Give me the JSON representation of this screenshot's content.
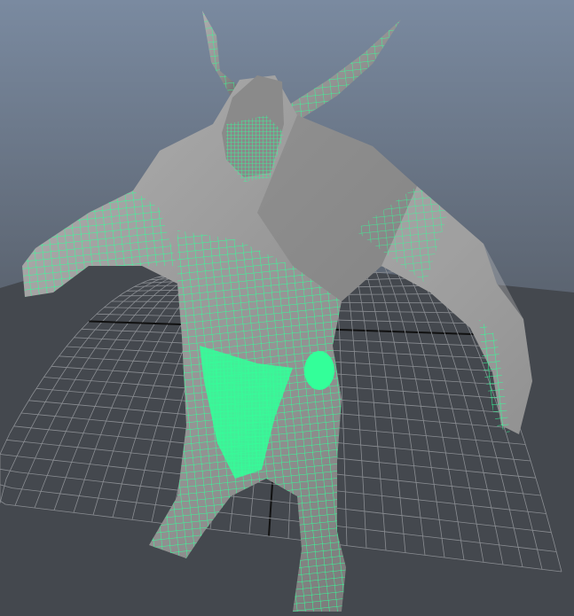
{
  "viewport": {
    "background_top": "#7a8aa0",
    "background_bottom": "#3b4048",
    "grid_color": "#8a8d92",
    "axis_color": "#111111",
    "floor_color": "#44484e",
    "mesh_color": "#9a9a9a",
    "mesh_shadow": "#6a6a6a",
    "wireframe_color": "#33ff99",
    "selected_object": "character-model"
  }
}
